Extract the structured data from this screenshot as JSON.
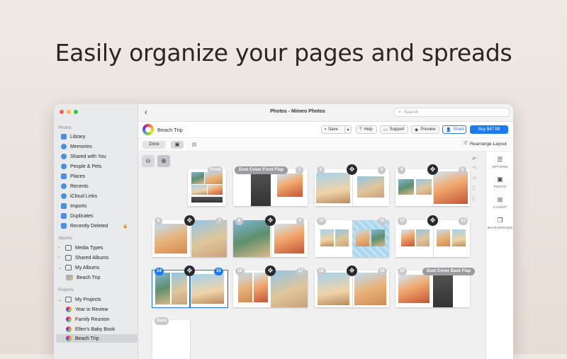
{
  "headline": "Easily organize your pages and spreads",
  "window": {
    "title": "Photos - Mimeo Photos",
    "search_placeholder": "Search"
  },
  "sidebar": {
    "sections": [
      {
        "title": "Photos",
        "items": [
          {
            "label": "Library",
            "icon": "library-icon"
          },
          {
            "label": "Memories",
            "icon": "memories-icon"
          },
          {
            "label": "Shared with You",
            "icon": "shared-with-you-icon"
          },
          {
            "label": "People & Pets",
            "icon": "people-icon"
          },
          {
            "label": "Places",
            "icon": "places-icon"
          },
          {
            "label": "Recents",
            "icon": "recents-icon"
          },
          {
            "label": "iCloud Links",
            "icon": "icloud-icon"
          },
          {
            "label": "Imports",
            "icon": "imports-icon"
          },
          {
            "label": "Duplicates",
            "icon": "duplicates-icon"
          },
          {
            "label": "Recently Deleted",
            "icon": "trash-icon"
          }
        ]
      },
      {
        "title": "Albums",
        "items": [
          {
            "label": "Media Types"
          },
          {
            "label": "Shared Albums"
          },
          {
            "label": "My Albums"
          },
          {
            "label": "Beach Trip"
          }
        ]
      },
      {
        "title": "Projects",
        "items": [
          {
            "label": "My Projects"
          },
          {
            "label": "Year in Review"
          },
          {
            "label": "Family Reunion"
          },
          {
            "label": "Ellen's Baby Book"
          },
          {
            "label": "Beach Trip"
          }
        ]
      }
    ]
  },
  "toolbar": {
    "project_name": "Beach Trip",
    "save": "Save",
    "help": "Help",
    "support": "Support",
    "preview": "Preview",
    "share": "Share",
    "buy": "Buy $47.99"
  },
  "subbar": {
    "done": "Done",
    "rearrange": "Rearrange Layout"
  },
  "right_panel": {
    "options": "OPTIONS",
    "photo": "PHOTO",
    "layout": "LAYOUT",
    "background": "BACKGROUND"
  },
  "pages": {
    "front": "Front",
    "dust_front": "Dust Cover Front Flap",
    "dust_back": "Dust Cover Back Flap",
    "back": "Back",
    "numbers": [
      "1",
      "2",
      "3",
      "4",
      "5",
      "6",
      "7",
      "8",
      "9",
      "10",
      "11",
      "12",
      "13",
      "14",
      "15",
      "16",
      "17",
      "18",
      "19",
      "20"
    ]
  },
  "colors": {
    "accent": "#1f7aed",
    "sidebar_bg": "#e9eaec",
    "canvas_bg": "#f0f0f1"
  }
}
